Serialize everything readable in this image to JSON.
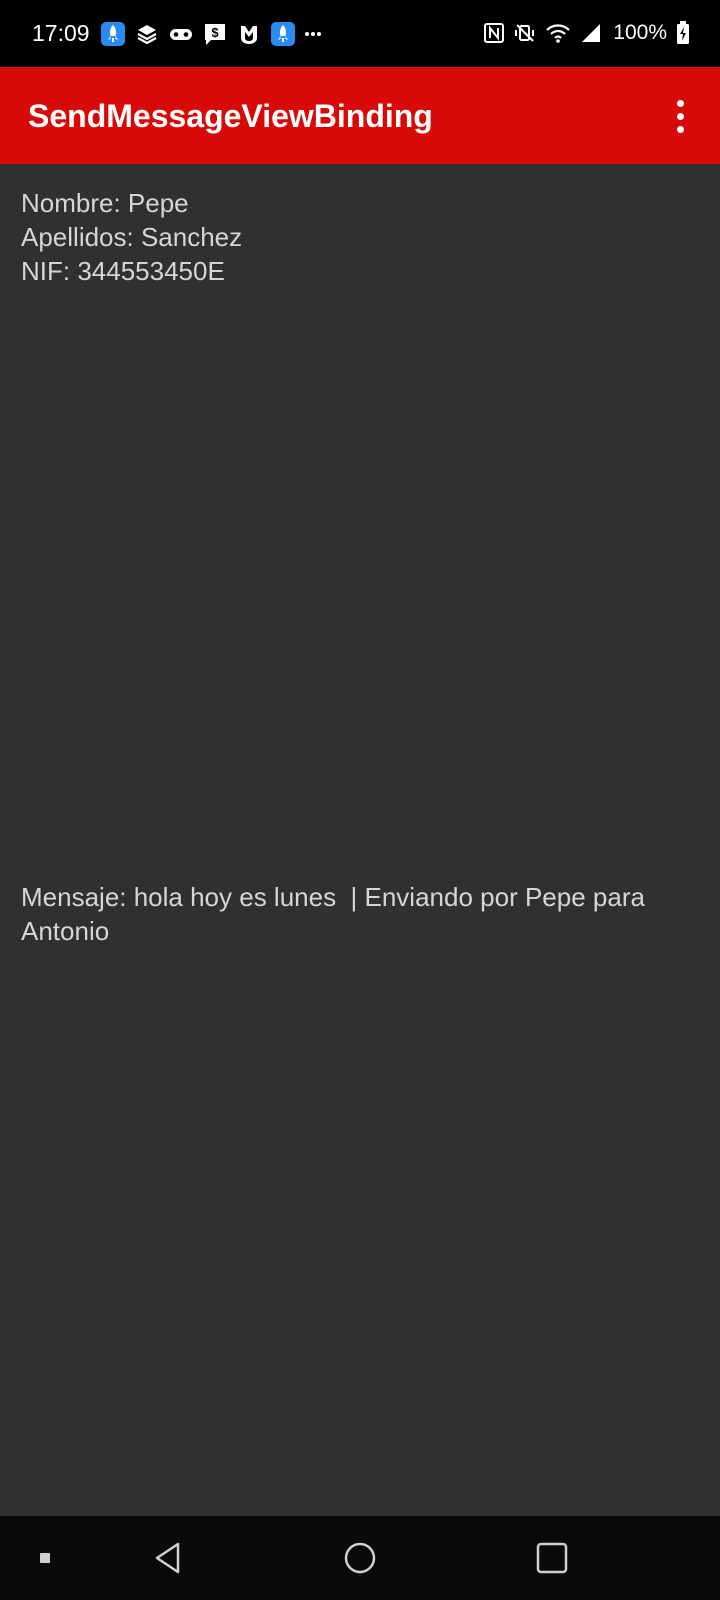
{
  "status_bar": {
    "time": "17:09",
    "notification_icons": [
      "rocket-app-icon",
      "layers-icon",
      "gamepad-icon",
      "dollar-message-icon",
      "shield-icon",
      "rocket-app-icon",
      "more-notifications-icon"
    ],
    "system_icons": [
      "nfc-icon",
      "vibrate-off-icon",
      "wifi-icon",
      "signal-icon",
      "battery-icon"
    ],
    "battery": "100%"
  },
  "app_bar": {
    "title": "SendMessageViewBinding",
    "overflow_icon": "more-vert-icon",
    "color": "#d80a08"
  },
  "content": {
    "info_lines": [
      "Nombre: Pepe",
      "Apellidos: Sanchez",
      "NIF: 344553450E"
    ],
    "message": "Mensaje: hola hoy es lunes  | Enviando por Pepe para Antonio"
  },
  "nav_bar": {
    "items": [
      "recents-dot-icon",
      "back-icon",
      "home-icon",
      "overview-icon"
    ]
  },
  "colors": {
    "background": "#303030",
    "accent": "#d80a08",
    "text": "#d6d6d6"
  }
}
